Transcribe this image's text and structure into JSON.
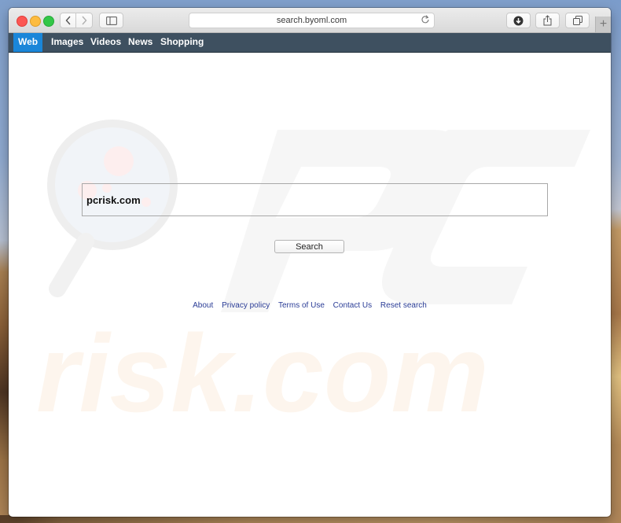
{
  "browser": {
    "address_bar": "search.byoml.com",
    "icons": {
      "close": "close-traffic-light",
      "minimize": "minimize-traffic-light",
      "maximize": "maximize-traffic-light",
      "back": "chevron-left-icon",
      "forward": "chevron-right-icon",
      "sidebar": "sidebar-icon",
      "reload": "reload-icon",
      "download": "download-icon",
      "share": "share-icon",
      "tabs": "tabs-overview-icon",
      "new_tab": "plus-icon"
    }
  },
  "navbar": {
    "items": [
      {
        "label": "Web",
        "active": true
      },
      {
        "label": "Images",
        "active": false
      },
      {
        "label": "Videos",
        "active": false
      },
      {
        "label": "News",
        "active": false
      },
      {
        "label": "Shopping",
        "active": false
      }
    ],
    "active_color": "#1a86d9",
    "bar_color": "#3e5060"
  },
  "search": {
    "query": "pcrisk.com",
    "button_label": "Search"
  },
  "footer": {
    "links": [
      "About",
      "Privacy policy",
      "Terms of Use",
      "Contact Us",
      "Reset search"
    ],
    "link_color": "#2a3c96"
  },
  "watermark": {
    "text_top": "PC",
    "text_bottom": "risk.com"
  }
}
